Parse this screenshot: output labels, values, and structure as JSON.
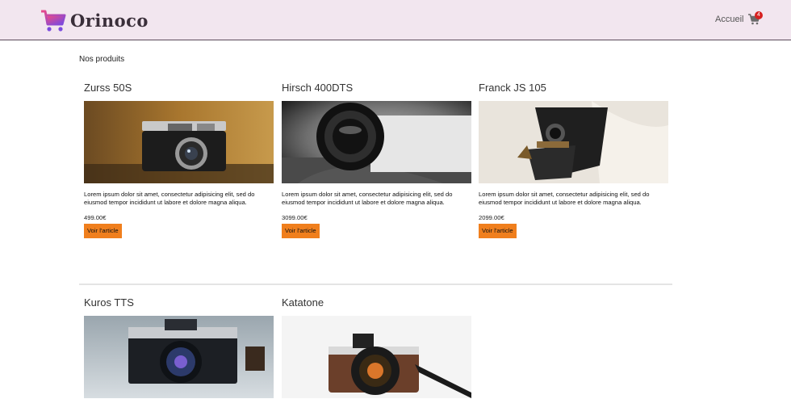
{
  "header": {
    "logo_text": "Orinoco",
    "nav_home": "Accueil",
    "cart_count": "4"
  },
  "main": {
    "section_title": "Nos produits",
    "products": [
      {
        "name": "Zurss 50S",
        "description": "Lorem ipsum dolor sit amet, consectetur adipisicing elit, sed do eiusmod tempor incididunt ut labore et dolore magna aliqua.",
        "price": "499.00€",
        "button": "Voir l'article",
        "image": "camera-photo-vintage"
      },
      {
        "name": "Hirsch 400DTS",
        "description": "Lorem ipsum dolor sit amet, consectetur adipisicing elit, sed do eiusmod tempor incididunt ut labore et dolore magna aliqua.",
        "price": "3099.00€",
        "button": "Voir l'article",
        "image": "camera-photo-bw"
      },
      {
        "name": "Franck JS 105",
        "description": "Lorem ipsum dolor sit amet, consectetur adipisicing elit, sed do eiusmod tempor incididunt ut labore et dolore magna aliqua.",
        "price": "2099.00€",
        "button": "Voir l'article",
        "image": "camera-photo-folding"
      },
      {
        "name": "Kuros TTS",
        "image": "camera-photo-minolta"
      },
      {
        "name": "Katatone",
        "image": "camera-photo-brown"
      }
    ]
  },
  "colors": {
    "header_bg": "#f2e6ef",
    "button_bg": "#f07f1d",
    "badge_bg": "#d62020",
    "logo_gradient_start": "#e84a8a",
    "logo_gradient_end": "#7a4adf"
  }
}
